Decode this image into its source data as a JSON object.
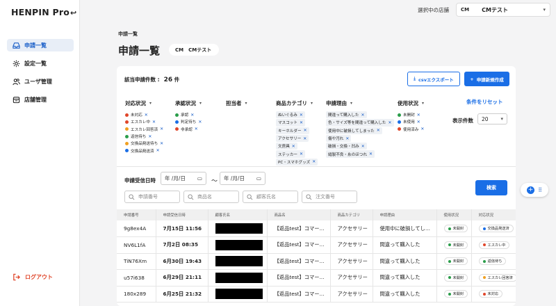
{
  "app": {
    "logo": "HENPIN Pro",
    "logo_arrow": "↩"
  },
  "sidebar": {
    "items": [
      {
        "label": "申請一覧",
        "icon": "inbox-icon"
      },
      {
        "label": "設定一覧",
        "icon": "gear-icon"
      },
      {
        "label": "ユーザ管理",
        "icon": "users-icon"
      },
      {
        "label": "店舗管理",
        "icon": "store-icon"
      }
    ],
    "logout": "ログアウト"
  },
  "topbar": {
    "store_label": "選択中の店舗",
    "store_logo": "CM",
    "store_name": "CMテスト"
  },
  "page": {
    "breadcrumb": "申請一覧",
    "title": "申請一覧",
    "chip_logo": "CM",
    "chip_label": "CMテスト"
  },
  "summary": {
    "label": "該当申請件数 :",
    "count": "26",
    "unit": "件"
  },
  "buttons": {
    "csv": "csvエクスポート",
    "new": "申請新規作成",
    "reset": "条件をリセット",
    "search": "検索"
  },
  "filters": {
    "taiou": {
      "title": "対応状況",
      "chips": [
        {
          "label": "未対応",
          "color": "#e0462a"
        },
        {
          "label": "エスカレ中",
          "color": "#e0462a"
        },
        {
          "label": "エスカレ回答済",
          "color": "#f0a020"
        },
        {
          "label": "返信待ち",
          "color": "#2a9d4a"
        },
        {
          "label": "交換品発送待ち",
          "color": "#f0a020"
        },
        {
          "label": "交換品発送済",
          "color": "#1a6ee6"
        }
      ]
    },
    "shounin": {
      "title": "承認状況",
      "chips": [
        {
          "label": "承認",
          "color": "#2a9d4a"
        },
        {
          "label": "判定待ち",
          "color": "#1a6ee6"
        },
        {
          "label": "非承認",
          "color": "#e0462a"
        }
      ]
    },
    "tantou": {
      "title": "担当者"
    },
    "category": {
      "title": "商品カテゴリ",
      "chips": [
        "ぬいぐるみ",
        "マスコット",
        "キーホルダー",
        "アクセサリー",
        "文房具",
        "ステッカー",
        "PC・スマホグッズ"
      ]
    },
    "reason": {
      "title": "申請理由",
      "chips": [
        "間違って購入した",
        "色・サイズ等を間違って購入した",
        "使用中に破損してしまった",
        "傷や汚れ",
        "破損・交換・凹み",
        "縫製不良・糸のほつれ"
      ]
    },
    "usage": {
      "title": "使用状況",
      "chips": [
        {
          "label": "未開封",
          "color": "#2a9d4a"
        },
        {
          "label": "未使用",
          "color": "#1a6ee6"
        },
        {
          "label": "使用済み",
          "color": "#e0462a"
        }
      ]
    }
  },
  "per_page": {
    "label": "表示件数",
    "value": "20"
  },
  "search": {
    "date_label": "申請受信日時",
    "date_from": "年 /月/日",
    "date_to": "年 /月/日",
    "tilde": "〜",
    "placeholders": {
      "app_no": "申請番号",
      "product": "商品名",
      "customer": "顧客氏名",
      "order": "注文番号"
    }
  },
  "table": {
    "headers": [
      "申請番号",
      "申請受信日時",
      "顧客氏名",
      "商品名",
      "商品カテゴリ",
      "申請理由",
      "使用状況",
      "対応状況"
    ],
    "rows": [
      {
        "id": "9g8ex4A",
        "date": "7月15日 11:56",
        "product": "【返品test】コマー...",
        "category": "アクセサリー",
        "reason": "使用中に破損してし...",
        "usage": "未開封",
        "usage_color": "#2a9d4a",
        "status": "交換品発送済",
        "status_color": "#1a6ee6"
      },
      {
        "id": "NV6L1fA",
        "date": "7月2日 08:35",
        "product": "【返品test】コマー...",
        "category": "アクセサリー",
        "reason": "間違って購入した",
        "usage": "未開封",
        "usage_color": "#2a9d4a",
        "status": "エスカレ中",
        "status_color": "#e0462a"
      },
      {
        "id": "TiN76Xm",
        "date": "6月30日 19:43",
        "product": "【返品test】コマー...",
        "category": "アクセサリー",
        "reason": "間違って購入した",
        "usage": "未開封",
        "usage_color": "#2a9d4a",
        "status": "返信待ち",
        "status_color": "#2a9d4a"
      },
      {
        "id": "u57i638",
        "date": "6月29日 21:11",
        "product": "【返品test】コマー...",
        "category": "アクセサリー",
        "reason": "間違って購入した",
        "usage": "未開封",
        "usage_color": "#2a9d4a",
        "status": "エスカレ回答済",
        "status_color": "#f0a020"
      },
      {
        "id": "180x289",
        "date": "6月25日 21:32",
        "product": "【返品test】コマー...",
        "category": "アクセサリー",
        "reason": "間違って購入した",
        "usage": "未開封",
        "usage_color": "#2a9d4a",
        "status": "未対応",
        "status_color": "#e0462a"
      }
    ]
  }
}
